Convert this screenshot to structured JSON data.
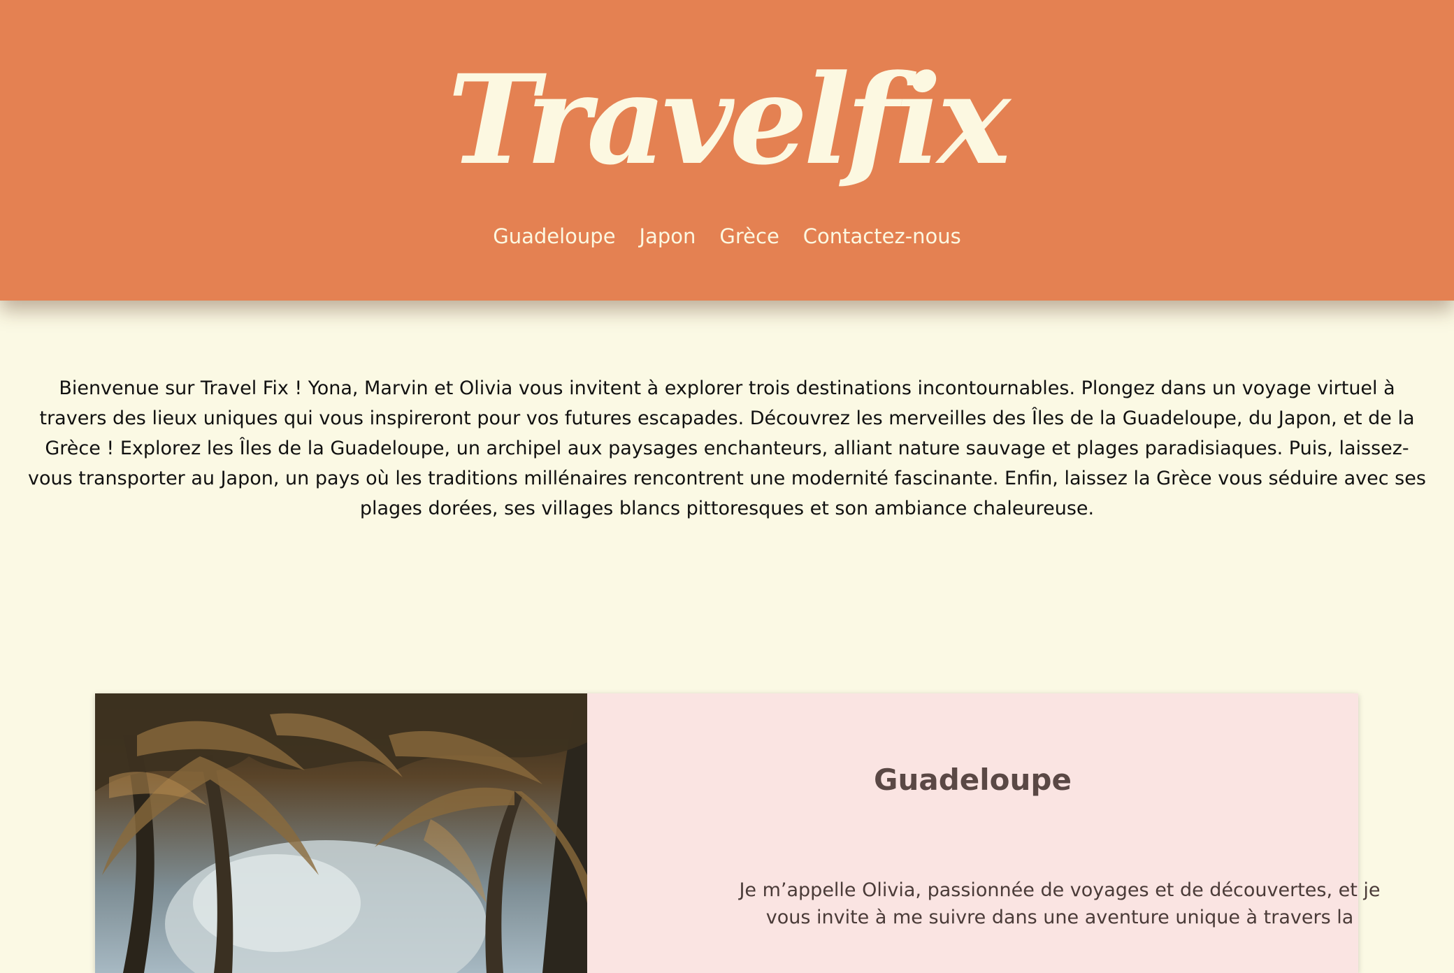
{
  "header": {
    "logo": "Travelfix",
    "brand_color": "#e48152",
    "logo_color": "#fcf8e1"
  },
  "nav": {
    "items": [
      {
        "label": "Guadeloupe"
      },
      {
        "label": "Japon"
      },
      {
        "label": "Grèce"
      },
      {
        "label": "Contactez-nous"
      }
    ]
  },
  "intro": {
    "text": "Bienvenue sur Travel Fix ! Yona, Marvin et Olivia vous invitent à explorer trois destinations incontournables. Plongez dans un voyage virtuel à travers des lieux uniques qui vous inspireront pour vos futures escapades. Découvrez les merveilles des Îles de la Guadeloupe, du Japon, et de la Grèce ! Explorez les Îles de la Guadeloupe, un archipel aux paysages enchanteurs, alliant nature sauvage et plages paradisiaques. Puis, laissez-vous transporter au Japon, un pays où les traditions millénaires rencontrent une modernité fascinante. Enfin, laissez la Grèce vous séduire avec ses plages dorées, ses villages blancs pittoresques et son ambiance chaleureuse."
  },
  "card": {
    "photo_icon": "palm-trees-photo",
    "title": "Guadeloupe",
    "text": "Je m’appelle Olivia, passionnée de voyages et de découvertes, et je vous invite à me suivre dans une aventure unique à travers la",
    "background_color": "#fae4e2"
  },
  "page": {
    "background_color": "#fbf9e4"
  }
}
